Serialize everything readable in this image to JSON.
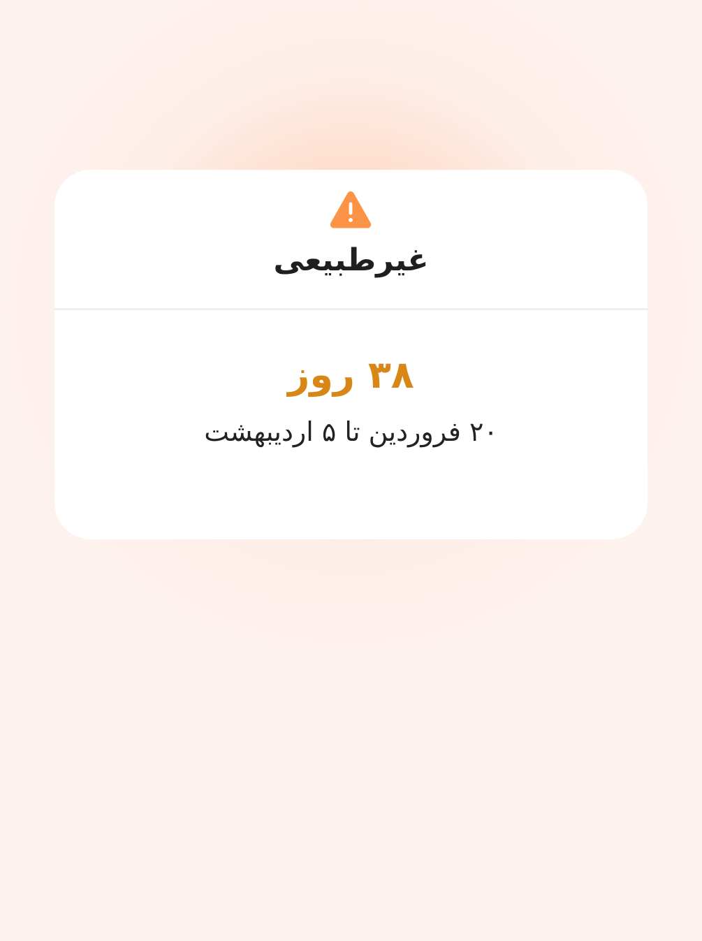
{
  "card": {
    "icon": "warning-triangle-icon",
    "status_title": "غیرطبیعی",
    "duration": "۳۸ روز",
    "date_range": "۲۰ فروردین تا ۵ اردیبهشت"
  },
  "colors": {
    "warning_icon": "#fb9446",
    "duration_text": "#d88717",
    "title_text": "#1f1f1f",
    "divider": "#efefef",
    "background": "#fef2ef",
    "glow": "#fcc4a0"
  }
}
